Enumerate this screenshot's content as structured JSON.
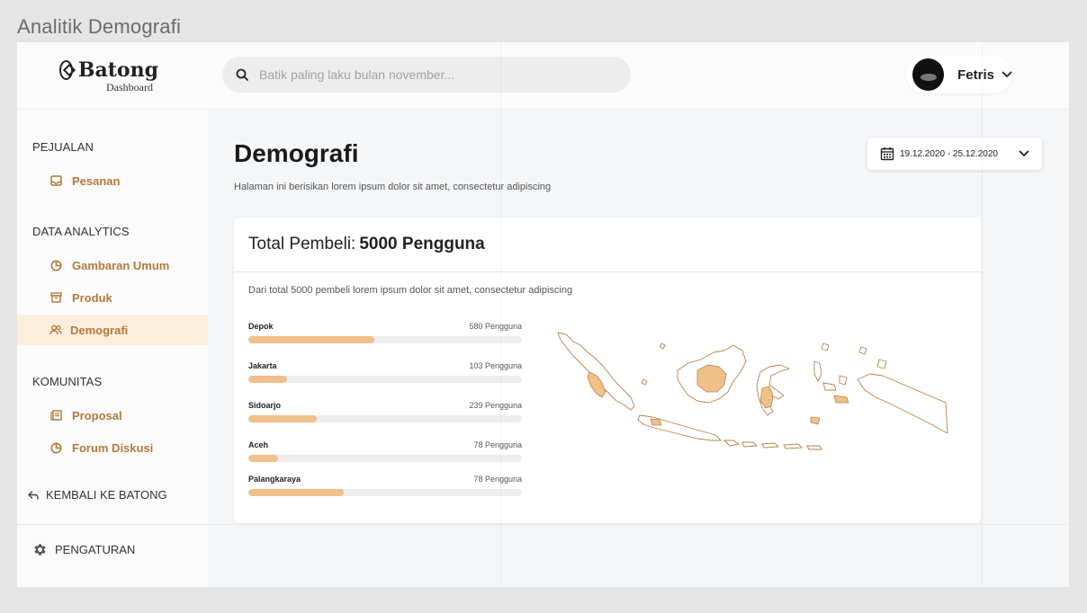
{
  "frame_title": "Analitik Demografi",
  "brand": {
    "name": "Batong",
    "subtitle": "Dashboard"
  },
  "search": {
    "placeholder": "Batik paling laku bulan november..."
  },
  "user": {
    "name": "Fetris"
  },
  "sidebar": {
    "sections": [
      {
        "title": "PEJUALAN",
        "items": [
          {
            "label": "Pesanan",
            "icon": "inbox-icon"
          }
        ]
      },
      {
        "title": "DATA ANALYTICS",
        "items": [
          {
            "label": "Gambaran Umum",
            "icon": "pie-chart-icon"
          },
          {
            "label": "Produk",
            "icon": "archive-icon"
          },
          {
            "label": "Demografi",
            "icon": "users-icon",
            "active": true
          }
        ]
      },
      {
        "title": "KOMUNITAS",
        "items": [
          {
            "label": "Proposal",
            "icon": "document-icon"
          },
          {
            "label": "Forum Diskusi",
            "icon": "pie-chart-icon"
          }
        ]
      }
    ],
    "back_label": "KEMBALI KE BATONG",
    "settings_label": "PENGATURAN"
  },
  "page": {
    "title": "Demografi",
    "description": "Halaman ini berisikan lorem ipsum dolor sit amet, consectetur adipiscing",
    "date_range": "19.12.2020 - 25.12.2020"
  },
  "card": {
    "title_prefix": "Total Pembeli:",
    "title_value": "5000 Pengguna",
    "description": "Dari total 5000 pembeli lorem ipsum dolor sit amet, consectetur adipiscing",
    "rows": [
      {
        "name": "Depok",
        "count": "580 Pengguna",
        "fraction": 0.46
      },
      {
        "name": "Jakarta",
        "count": "103 Pengguna",
        "fraction": 0.14
      },
      {
        "name": "Sidoarjo",
        "count": "239 Pengguna",
        "fraction": 0.25
      },
      {
        "name": "Aceh",
        "count": "78 Pengguna",
        "fraction": 0.11
      },
      {
        "name": "Palangkaraya",
        "count": "78 Pengguna",
        "fraction": 0.35
      }
    ]
  },
  "colors": {
    "accent": "#b37a3a",
    "active_bg": "#fbeedd",
    "bar_fill": "#f2c08a",
    "bar_track": "#eeeeee",
    "map_outline": "#b9824a",
    "map_fill": "#f0c08a"
  }
}
